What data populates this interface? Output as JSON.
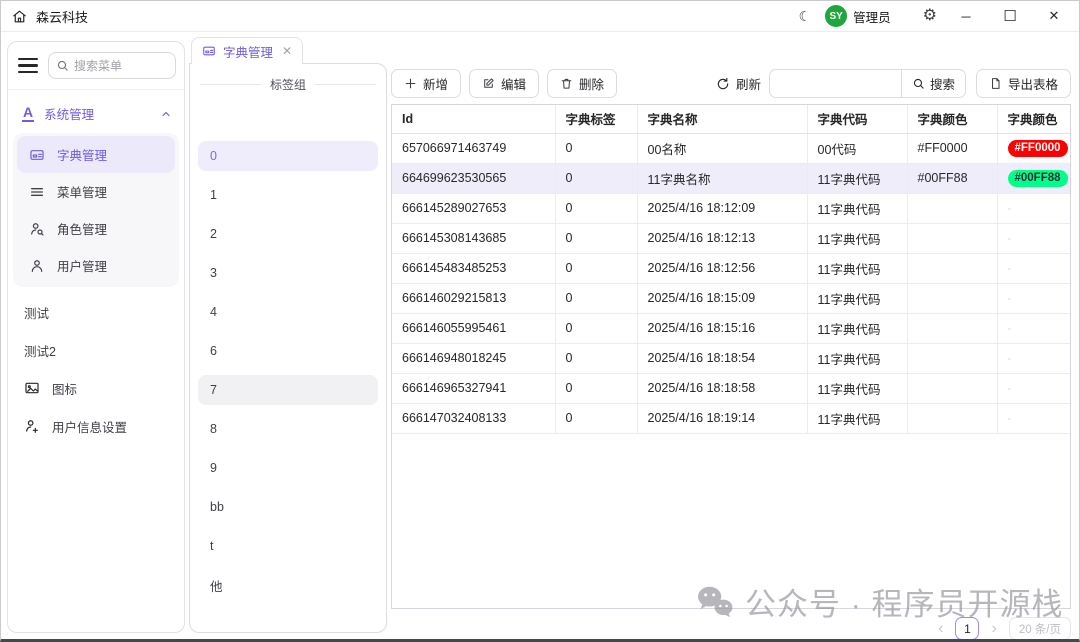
{
  "titlebar": {
    "title": "森云科技",
    "user_label": "管理员",
    "avatar_initials": "SY"
  },
  "icons": {
    "moon": "☾",
    "gear": "⚙",
    "minimize": "─",
    "maximize": "☐",
    "close": "✕",
    "tab_close": "✕",
    "chevron_left": "‹",
    "chevron_right": "›"
  },
  "sidebar": {
    "search_placeholder": "搜索菜单",
    "group": {
      "label": "系统管理",
      "icon_letter": "A"
    },
    "group_items": [
      {
        "label": "字典管理",
        "icon": "dict",
        "selected": true
      },
      {
        "label": "菜单管理",
        "icon": "menu",
        "selected": false
      },
      {
        "label": "角色管理",
        "icon": "role",
        "selected": false
      },
      {
        "label": "用户管理",
        "icon": "user",
        "selected": false
      }
    ],
    "items": [
      {
        "label": "测试",
        "icon": null
      },
      {
        "label": "测试2",
        "icon": null
      },
      {
        "label": "图标",
        "icon": "image"
      },
      {
        "label": "用户信息设置",
        "icon": "userplus"
      }
    ]
  },
  "tabs": [
    {
      "label": "字典管理",
      "active": true
    }
  ],
  "tag_panel": {
    "title": "标签组",
    "items": [
      "0",
      "1",
      "2",
      "3",
      "4",
      "6",
      "7",
      "8",
      "9",
      "bb",
      "t",
      "他"
    ],
    "selected": "0",
    "hovered": "7"
  },
  "toolbar": {
    "add_label": "新增",
    "edit_label": "编辑",
    "delete_label": "删除",
    "refresh_label": "刷新",
    "search_label": "搜索",
    "export_label": "导出表格",
    "search_value": ""
  },
  "table": {
    "columns": [
      "Id",
      "字典标签",
      "字典名称",
      "字典代码",
      "字典颜色",
      "字典颜色"
    ],
    "rows": [
      {
        "id": "657066971463749",
        "label": "0",
        "name": "00名称",
        "code": "00代码",
        "color": "#FF0000",
        "badge": {
          "text": "#FF0000",
          "bg": "#FF0000",
          "fg": "#ffffff"
        },
        "selected": false
      },
      {
        "id": "664699623530565",
        "label": "0",
        "name": "11字典名称",
        "code": "11字典代码",
        "color": "#00FF88",
        "badge": {
          "text": "#00FF88",
          "bg": "#00FF88",
          "fg": "#1f2937"
        },
        "selected": true
      },
      {
        "id": "666145289027653",
        "label": "0",
        "name": "2025/4/16 18:12:09",
        "code": "11字典代码",
        "color": "",
        "badge": {
          "text": "-",
          "bg": "",
          "fg": "#d4d4d8"
        },
        "selected": false
      },
      {
        "id": "666145308143685",
        "label": "0",
        "name": "2025/4/16 18:12:13",
        "code": "11字典代码",
        "color": "",
        "badge": {
          "text": "-",
          "bg": "",
          "fg": "#d4d4d8"
        },
        "selected": false
      },
      {
        "id": "666145483485253",
        "label": "0",
        "name": "2025/4/16 18:12:56",
        "code": "11字典代码",
        "color": "",
        "badge": {
          "text": "-",
          "bg": "",
          "fg": "#d4d4d8"
        },
        "selected": false
      },
      {
        "id": "666146029215813",
        "label": "0",
        "name": "2025/4/16 18:15:09",
        "code": "11字典代码",
        "color": "",
        "badge": {
          "text": "-",
          "bg": "",
          "fg": "#d4d4d8"
        },
        "selected": false
      },
      {
        "id": "666146055995461",
        "label": "0",
        "name": "2025/4/16 18:15:16",
        "code": "11字典代码",
        "color": "",
        "badge": {
          "text": "-",
          "bg": "",
          "fg": "#d4d4d8"
        },
        "selected": false
      },
      {
        "id": "666146948018245",
        "label": "0",
        "name": "2025/4/16 18:18:54",
        "code": "11字典代码",
        "color": "",
        "badge": {
          "text": "-",
          "bg": "",
          "fg": "#d4d4d8"
        },
        "selected": false
      },
      {
        "id": "666146965327941",
        "label": "0",
        "name": "2025/4/16 18:18:58",
        "code": "11字典代码",
        "color": "",
        "badge": {
          "text": "-",
          "bg": "",
          "fg": "#d4d4d8"
        },
        "selected": false
      },
      {
        "id": "666147032408133",
        "label": "0",
        "name": "2025/4/16 18:19:14",
        "code": "11字典代码",
        "color": "",
        "badge": {
          "text": "-",
          "bg": "",
          "fg": "#d4d4d8"
        },
        "selected": false
      }
    ]
  },
  "pagination": {
    "page": "1",
    "page_size": "20 条/页"
  },
  "watermark": {
    "text": "公众号 · 程序员开源栈"
  },
  "colors": {
    "accent": "#6E5CE6",
    "selected_bg": "#ECE9FB",
    "row_selected_bg": "#EFEDFA",
    "badge_red": "#FF0000",
    "badge_green": "#00FF88",
    "avatar_green": "#1FA63C"
  }
}
